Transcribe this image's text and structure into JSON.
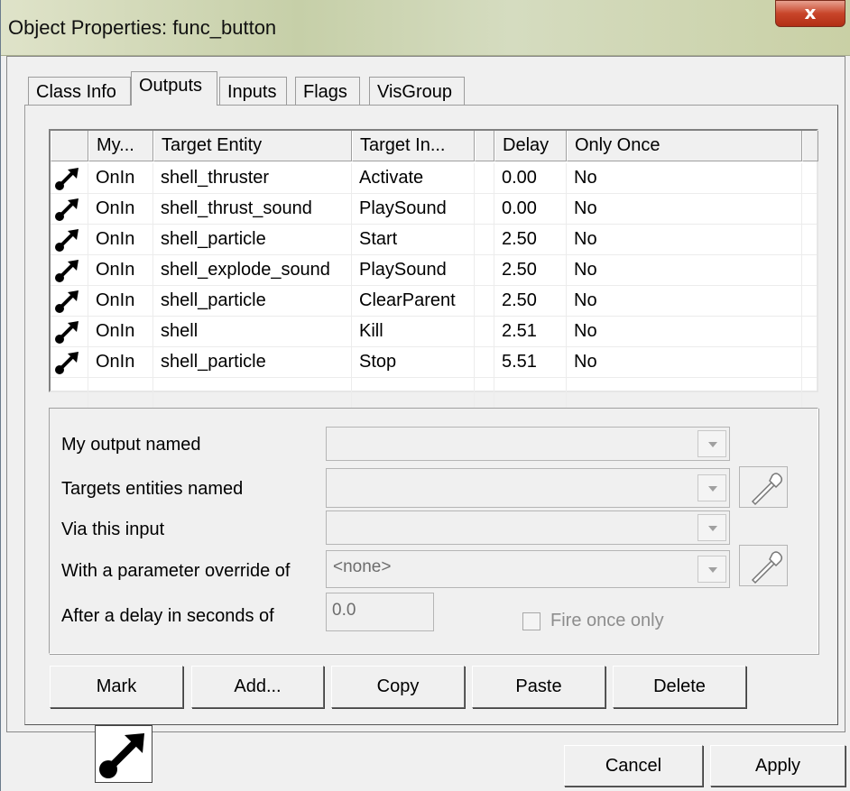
{
  "window": {
    "title": "Object Properties: func_button",
    "close_glyph": "x"
  },
  "tabs": [
    {
      "label": "Class Info",
      "active": false
    },
    {
      "label": "Outputs",
      "active": true
    },
    {
      "label": "Inputs",
      "active": false
    },
    {
      "label": "Flags",
      "active": false
    },
    {
      "label": "VisGroup",
      "active": false
    }
  ],
  "grid": {
    "columns": [
      "",
      "My...",
      "Target Entity",
      "Target In...",
      "",
      "Delay",
      "Only Once"
    ],
    "rows": [
      {
        "icon": "output-connection-icon",
        "my_output": "OnIn",
        "target_entity": "shell_thruster",
        "target_input": "Activate",
        "delay": "0.00",
        "only_once": "No"
      },
      {
        "icon": "output-connection-icon",
        "my_output": "OnIn",
        "target_entity": "shell_thrust_sound",
        "target_input": "PlaySound",
        "delay": "0.00",
        "only_once": "No"
      },
      {
        "icon": "output-connection-icon",
        "my_output": "OnIn",
        "target_entity": "shell_particle",
        "target_input": "Start",
        "delay": "2.50",
        "only_once": "No"
      },
      {
        "icon": "output-connection-icon",
        "my_output": "OnIn",
        "target_entity": "shell_explode_sound",
        "target_input": "PlaySound",
        "delay": "2.50",
        "only_once": "No"
      },
      {
        "icon": "output-connection-icon",
        "my_output": "OnIn",
        "target_entity": "shell_particle",
        "target_input": "ClearParent",
        "delay": "2.50",
        "only_once": "No"
      },
      {
        "icon": "output-connection-icon",
        "my_output": "OnIn",
        "target_entity": "shell",
        "target_input": "Kill",
        "delay": "2.51",
        "only_once": "No"
      },
      {
        "icon": "output-connection-icon",
        "my_output": "OnIn",
        "target_entity": "shell_particle",
        "target_input": "Stop",
        "delay": "5.51",
        "only_once": "No"
      }
    ]
  },
  "editor": {
    "output_label": "My output named",
    "output_value": "",
    "targets_label": "Targets entities named",
    "targets_value": "",
    "input_label": "Via this input",
    "input_value": "",
    "parameter_label": "With a parameter override of",
    "parameter_value": "<none>",
    "delay_label": "After a delay in seconds of",
    "delay_value": "0.0",
    "fire_once_label": "Fire once only",
    "fire_once_checked": false
  },
  "actions": {
    "mark": "Mark",
    "add": "Add...",
    "copy": "Copy",
    "paste": "Paste",
    "delete": "Delete"
  },
  "footer": {
    "cancel": "Cancel",
    "apply": "Apply",
    "status_icon": "output-connection-icon"
  }
}
